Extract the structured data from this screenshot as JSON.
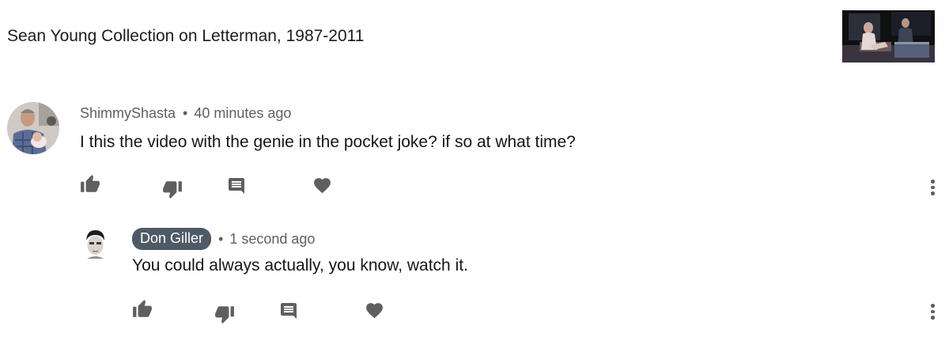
{
  "video": {
    "title": "Sean Young Collection on Letterman, 1987-2011",
    "thumbnail_icon": "video-thumbnail"
  },
  "comments": [
    {
      "author": "ShimmyShasta",
      "separator": "•",
      "time": "40 minutes ago",
      "text": "I this the video with the genie in the pocket joke? if so at what time?",
      "avatar_icon": "user-avatar"
    },
    {
      "author": "Don Giller",
      "separator": "•",
      "time": "1 second ago",
      "text": "You could always actually, you know, watch it.",
      "avatar_icon": "user-avatar",
      "author_highlighted": true
    }
  ],
  "actions": {
    "like_icon": "thumbs-up-icon",
    "dislike_icon": "thumbs-down-icon",
    "reply_icon": "comment-icon",
    "heart_icon": "heart-icon",
    "more_icon": "more-vert-icon"
  },
  "colors": {
    "icon_gray": "#5f5f5f",
    "meta_gray": "#606060",
    "author_chip_bg": "#4f5a67",
    "author_chip_text": "#ffffff"
  }
}
